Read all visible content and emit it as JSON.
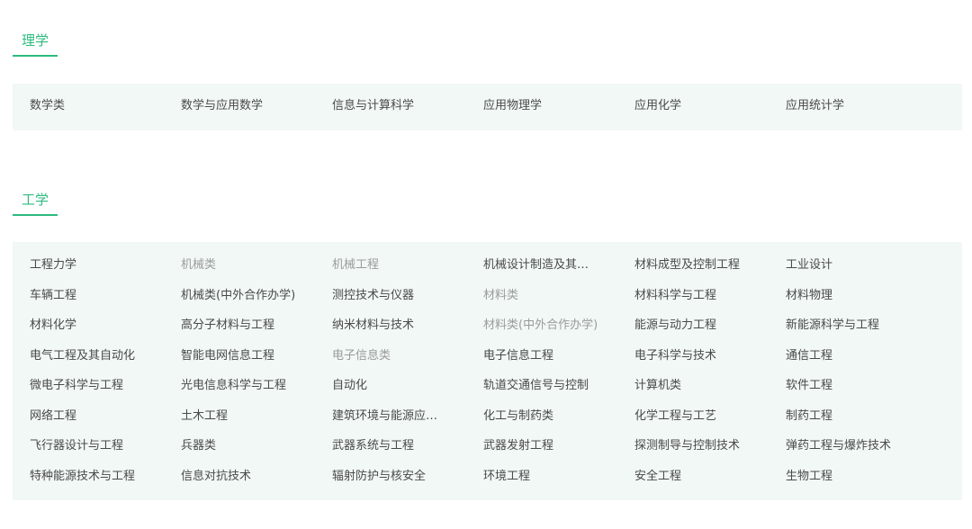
{
  "sections": [
    {
      "title": "理学",
      "rows": [
        [
          {
            "label": "数学类"
          },
          {
            "label": "数学与应用数学"
          },
          {
            "label": "信息与计算科学"
          },
          {
            "label": "应用物理学"
          },
          {
            "label": "应用化学"
          },
          {
            "label": "应用统计学"
          }
        ]
      ]
    },
    {
      "title": "工学",
      "rows": [
        [
          {
            "label": "工程力学"
          },
          {
            "label": "机械类",
            "muted": true
          },
          {
            "label": "机械工程",
            "muted": true
          },
          {
            "label": "机械设计制造及其自动化"
          },
          {
            "label": "材料成型及控制工程"
          },
          {
            "label": "工业设计"
          }
        ],
        [
          {
            "label": "车辆工程"
          },
          {
            "label": "机械类(中外合作办学)"
          },
          {
            "label": "测控技术与仪器"
          },
          {
            "label": "材料类",
            "muted": true
          },
          {
            "label": "材料科学与工程"
          },
          {
            "label": "材料物理"
          }
        ],
        [
          {
            "label": "材料化学"
          },
          {
            "label": "高分子材料与工程"
          },
          {
            "label": "纳米材料与技术"
          },
          {
            "label": "材料类(中外合作办学)",
            "muted": true
          },
          {
            "label": "能源与动力工程"
          },
          {
            "label": "新能源科学与工程"
          }
        ],
        [
          {
            "label": "电气工程及其自动化"
          },
          {
            "label": "智能电网信息工程"
          },
          {
            "label": "电子信息类",
            "muted": true
          },
          {
            "label": "电子信息工程"
          },
          {
            "label": "电子科学与技术"
          },
          {
            "label": "通信工程"
          }
        ],
        [
          {
            "label": "微电子科学与工程"
          },
          {
            "label": "光电信息科学与工程"
          },
          {
            "label": "自动化"
          },
          {
            "label": "轨道交通信号与控制"
          },
          {
            "label": "计算机类"
          },
          {
            "label": "软件工程"
          }
        ],
        [
          {
            "label": "网络工程"
          },
          {
            "label": "土木工程"
          },
          {
            "label": "建筑环境与能源应用工程"
          },
          {
            "label": "化工与制药类"
          },
          {
            "label": "化学工程与工艺"
          },
          {
            "label": "制药工程"
          }
        ],
        [
          {
            "label": "飞行器设计与工程"
          },
          {
            "label": "兵器类"
          },
          {
            "label": "武器系统与工程"
          },
          {
            "label": "武器发射工程"
          },
          {
            "label": "探测制导与控制技术"
          },
          {
            "label": "弹药工程与爆炸技术"
          }
        ],
        [
          {
            "label": "特种能源技术与工程"
          },
          {
            "label": "信息对抗技术"
          },
          {
            "label": "辐射防护与核安全"
          },
          {
            "label": "环境工程"
          },
          {
            "label": "安全工程"
          },
          {
            "label": "生物工程"
          }
        ]
      ]
    }
  ]
}
